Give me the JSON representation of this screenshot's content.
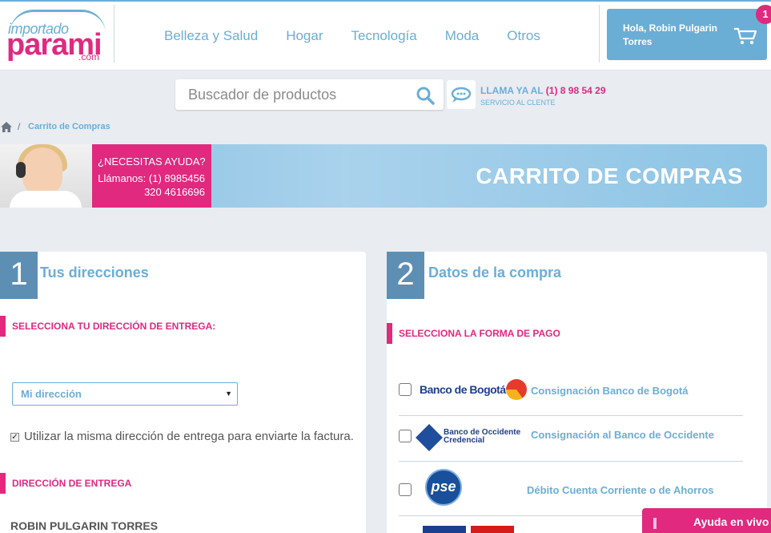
{
  "header": {
    "logo": {
      "top": "importado",
      "main": "parami",
      "suffix": ".com"
    },
    "nav": [
      "Belleza y Salud",
      "Hogar",
      "Tecnología",
      "Moda",
      "Otros"
    ],
    "user_greeting": "Hola, Robin Pulgarin Torres",
    "cart_count": "1"
  },
  "search": {
    "placeholder": "Buscador de productos",
    "call_label": "LLAMA YA AL ",
    "call_number": "(1) 8 98 54 29",
    "call_sub": "SERVICIO AL CLENTE"
  },
  "breadcrumb": {
    "separator": "/",
    "current": "Carrito de Compras"
  },
  "banner": {
    "help_title": "¿NECESITAS AYUDA?",
    "help_line1": "Llámanos: (1) 8985456",
    "help_line2": "320 4616696",
    "title": "CARRITO DE COMPRAS"
  },
  "left_panel": {
    "step": "1",
    "title": "Tus direcciones",
    "select_label": "SELECCIONA TU DIRECCIÓN DE ENTREGA:",
    "select_value": "Mi dirección",
    "checkbox_text": "Utilizar la misma dirección de entrega para enviarte la factura.",
    "delivery_label": "DIRECCIÓN DE ENTREGA",
    "person_name": "ROBIN PULGARIN TORRES"
  },
  "right_panel": {
    "step": "2",
    "title": "Datos de la compra",
    "payment_label": "SELECCIONA LA FORMA DE PAGO",
    "options": [
      {
        "bank": "Banco de Bogotá",
        "label": "Consignación Banco de Bogotá"
      },
      {
        "bank_line1": "Banco de Occidente",
        "bank_line2": "Credencial",
        "label": "Consignación al Banco de Occidente"
      },
      {
        "bank": "pse",
        "label": "Débito Cuenta Corriente o de Ahorros"
      }
    ]
  },
  "live_help": "Ayuda en vivo",
  "colors": {
    "accent_blue": "#6aaed6",
    "accent_pink": "#e0297f",
    "step_blue": "#5d8fb5"
  }
}
